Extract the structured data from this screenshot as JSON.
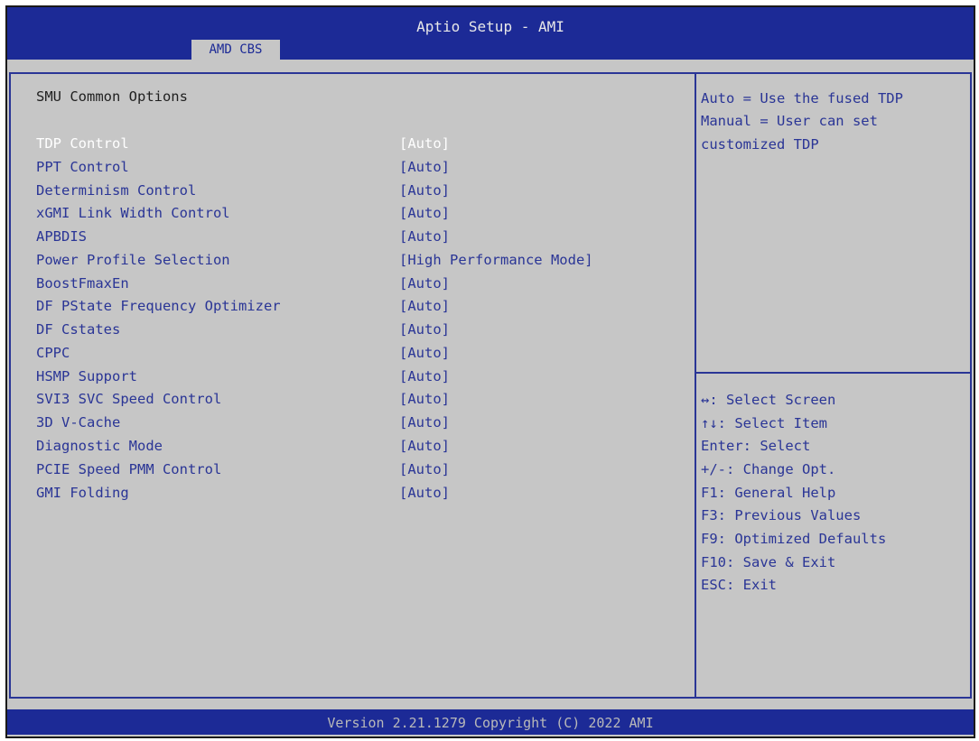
{
  "header": {
    "title": "Aptio Setup - AMI",
    "tab_label": "AMD CBS"
  },
  "main": {
    "section_title": "SMU Common Options",
    "items": [
      {
        "label": "TDP Control",
        "value": "[Auto]",
        "selected": true
      },
      {
        "label": "PPT Control",
        "value": "[Auto]"
      },
      {
        "label": "Determinism Control",
        "value": "[Auto]"
      },
      {
        "label": "xGMI Link Width Control",
        "value": "[Auto]"
      },
      {
        "label": "APBDIS",
        "value": "[Auto]"
      },
      {
        "label": "Power Profile Selection",
        "value": "[High Performance Mode]"
      },
      {
        "label": "BoostFmaxEn",
        "value": "[Auto]"
      },
      {
        "label": "DF PState Frequency Optimizer",
        "value": "[Auto]"
      },
      {
        "label": "DF Cstates",
        "value": "[Auto]"
      },
      {
        "label": "CPPC",
        "value": "[Auto]"
      },
      {
        "label": "HSMP Support",
        "value": "[Auto]"
      },
      {
        "label": "SVI3 SVC Speed Control",
        "value": "[Auto]"
      },
      {
        "label": "3D V-Cache",
        "value": "[Auto]"
      },
      {
        "label": "Diagnostic Mode",
        "value": "[Auto]"
      },
      {
        "label": "PCIE Speed PMM Control",
        "value": "[Auto]"
      },
      {
        "label": "GMI Folding",
        "value": "[Auto]"
      }
    ]
  },
  "help": {
    "lines": [
      "Auto = Use the fused TDP",
      "Manual = User can set",
      "customized TDP"
    ]
  },
  "keys": {
    "lines": [
      "↔: Select Screen",
      "↑↓: Select Item",
      "Enter: Select",
      "+/-: Change Opt.",
      "F1: General Help",
      "F3: Previous Values",
      "F9: Optimized Defaults",
      "F10: Save & Exit",
      "ESC: Exit"
    ]
  },
  "footer": {
    "text": "Version 2.21.1279 Copyright (C) 2022 AMI"
  },
  "colors": {
    "header_bg": "#1c2a96",
    "panel_bg": "#c6c6c6",
    "item_text": "#2a3596",
    "selected_text": "#ffffff",
    "footer_text": "#b9b9b9"
  }
}
